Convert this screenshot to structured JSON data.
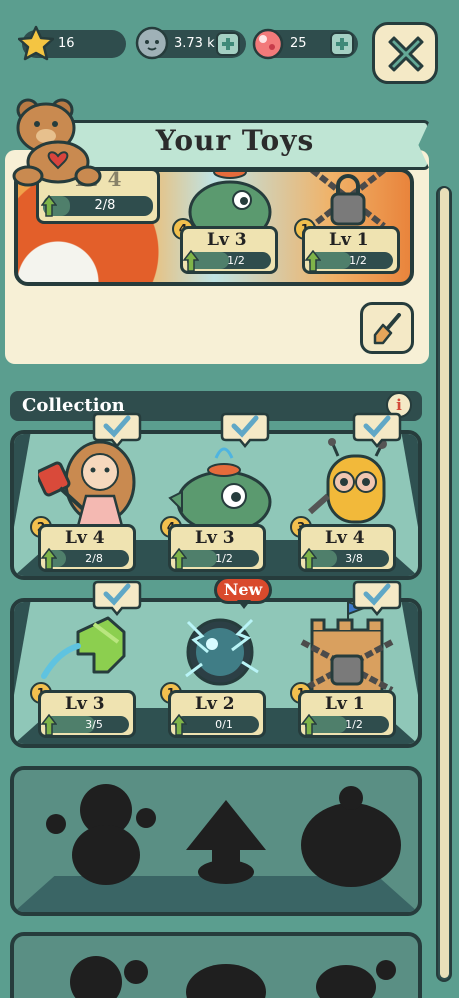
{
  "currencies": {
    "stars": "16",
    "coins": "3.73 k",
    "gems": "25"
  },
  "your_toys": {
    "title": "Your Toys",
    "slots": [
      {
        "level": "Lv 4",
        "progress": "2/8",
        "progress_fraction": 0.25
      },
      {
        "level": "Lv 3",
        "progress": "1/2",
        "progress_fraction": 0.5,
        "count": "4"
      },
      {
        "level": "Lv 1",
        "progress": "1/2",
        "progress_fraction": 0.5,
        "count": "1"
      }
    ]
  },
  "collection": {
    "title": "Collection",
    "info_label": "i",
    "new_label": "New",
    "rows": [
      [
        {
          "level": "Lv 4",
          "progress": "2/8",
          "progress_fraction": 0.25,
          "count": "2",
          "art": "princess-doll-icon"
        },
        {
          "level": "Lv 3",
          "progress": "1/2",
          "progress_fraction": 0.5,
          "count": "4",
          "art": "fish-fountain-icon"
        },
        {
          "level": "Lv 4",
          "progress": "3/8",
          "progress_fraction": 0.375,
          "count": "3",
          "art": "robot-icon"
        }
      ],
      [
        {
          "level": "Lv 3",
          "progress": "3/5",
          "progress_fraction": 0.6,
          "count": "1",
          "art": "water-gun-icon"
        },
        {
          "level": "Lv 2",
          "progress": "0/1",
          "progress_fraction": 0.0,
          "count": "1",
          "art": "plasma-ball-icon"
        },
        {
          "level": "Lv 1",
          "progress": "1/2",
          "progress_fraction": 0.5,
          "count": "1",
          "art": "sand-castle-icon"
        }
      ]
    ]
  },
  "colors": {
    "background": "#5b9e8f",
    "panel_dark": "#2f4d4d",
    "card": "#efe3b1",
    "new_red": "#d94a2c",
    "check_blue": "#5fa7c6"
  }
}
